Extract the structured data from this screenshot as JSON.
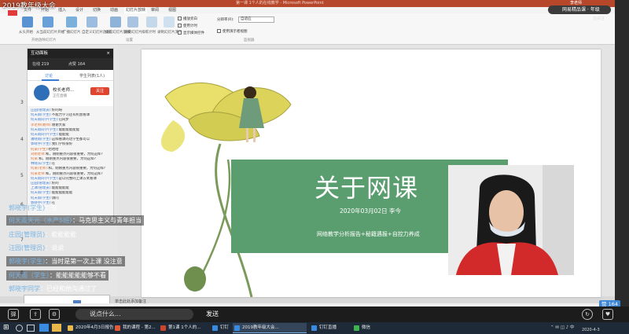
{
  "live": {
    "title": "2019教年级大会",
    "top_right_badge": "网易精品课 · 年级",
    "top_right_sub": "加关注"
  },
  "ppt": {
    "window_title": "第一课 1个人的在线教学 - Microsoft PowerPoint",
    "user": "李老师",
    "tabs": [
      "文件",
      "开始",
      "插入",
      "设计",
      "切换",
      "动画",
      "幻灯片放映",
      "审阅",
      "视图"
    ],
    "ribbon": {
      "buttons": [
        "从头开始",
        "从当前幻灯片开始",
        "广播幻灯片",
        "自定义幻灯片放映",
        "设置幻灯片放映",
        "隐藏幻灯片",
        "排练计时",
        "录制幻灯片演示"
      ],
      "groups": [
        "开始放映幻灯片",
        "设置",
        "监视器"
      ],
      "checks": [
        "播放旁白",
        "使用计时",
        "显示媒体控件"
      ],
      "resolution_label": "分辨率(R):",
      "resolution_value": "自适应",
      "presenter_view": "使用演示者视图"
    },
    "thumb_numbers": [
      "3",
      "4",
      "5",
      "6",
      "7",
      "8"
    ],
    "notes": "单击此处添加备注"
  },
  "slide": {
    "title": "关于网课",
    "date_line": "2020年03月02日 李今",
    "subtitle": "网络教学分析报告+秘籍遇报+自控力养成"
  },
  "panel": {
    "header": "互动面板",
    "close": "×",
    "online": "在线 219",
    "likes": "点赞 164",
    "tab_chat": "讨论",
    "tab_members": "学生列表(1人)",
    "teacher_name": "校长老师...",
    "teacher_role": "正在直播",
    "teacher_btn": "关注",
    "lines": [
      {
        "who": "庄园(管理员):",
        "msg": "好的呀",
        "color": "#3a7bd5"
      },
      {
        "who": "何天雨(学生):",
        "msg": "不能力学习还有机会看课",
        "color": "#3a7bd5"
      },
      {
        "who": "何天雨同学(学生):",
        "msg": "已同步",
        "color": "#3a7bd5"
      },
      {
        "who": "李老师(教师):",
        "msg": "谢谢大家",
        "color": "#e26b2a"
      },
      {
        "who": "何天雨同学(学生):",
        "msg": "能能能能能能",
        "color": "#3a7bd5"
      },
      {
        "who": "何天雨同学(学生):",
        "msg": "能能能",
        "color": "#3a7bd5"
      },
      {
        "who": "潘晓雨(学生):",
        "msg": "这样看课的话学生都可以",
        "color": "#3a7bd5"
      },
      {
        "who": "郭晓宇(学生):",
        "msg": "我们学校很好",
        "color": "#3a7bd5"
      },
      {
        "who": "何某(学生):",
        "msg": "哈哈哈",
        "color": "#e26b2a"
      },
      {
        "who": "刘刚老师:",
        "msg": "和，刚刚重点内容很重要，为何这样?",
        "color": "#e26b2a"
      },
      {
        "who": "何某:",
        "msg": "和，刚刚重点内容很重要，为何这样?",
        "color": "#e26b2a"
      },
      {
        "who": "林晓东(学生):",
        "msg": "在",
        "color": "#3a7bd5"
      },
      {
        "who": "何某(老师):",
        "msg": "和，刚刚重点内容很重要，为何这样?",
        "color": "#e26b2a"
      },
      {
        "who": "何某老师:",
        "msg": "和，刚刚重点内容很重要，为何这样?",
        "color": "#e26b2a"
      },
      {
        "who": "何天雨同学(学生):",
        "msg": "是以完整的上课方式看课",
        "color": "#3a7bd5"
      },
      {
        "who": "庄园(管理员):",
        "msg": "好的",
        "color": "#3a7bd5"
      },
      {
        "who": "上课(管理员):",
        "msg": "能能能能能",
        "color": "#3a7bd5"
      },
      {
        "who": "何天雨(学生):",
        "msg": "能能能能能能",
        "color": "#3a7bd5"
      },
      {
        "who": "何天雨(学生):",
        "msg": "请问",
        "color": "#3a7bd5"
      },
      {
        "who": "郭晓宇(学生):",
        "msg": "在",
        "color": "#3a7bd5"
      }
    ]
  },
  "danmaku": [
    {
      "name": "郭晓宇(学生)",
      "msg": "：在"
    },
    {
      "name": "何天雨天元（水产5班）",
      "msg": "：马克思主义与青年担当"
    },
    {
      "name": "庄园(管理员)",
      "msg": "：能能能能"
    },
    {
      "name": "汪园(管理员)",
      "msg": "：说说"
    },
    {
      "name": "郭晓宇(学生)",
      "msg": "：当时是第一次上课 没注意"
    },
    {
      "name": "何天雨（学生）",
      "msg": "：能能能能能够不看"
    },
    {
      "name": "郭晓宇同学",
      "msg": "：已经和他沟通过了"
    }
  ],
  "input": {
    "placeholder": "说点什么...",
    "send": "发送",
    "count": "赞 164"
  },
  "taskbar": {
    "items": [
      {
        "label": "2020年4月3日报告",
        "color": "#e8b84a"
      },
      {
        "label": "我的课程 - 第2...",
        "color": "#e05a3a"
      },
      {
        "label": "第1课 1个人的...",
        "color": "#c9452b"
      },
      {
        "label": "钉钉",
        "color": "#3a8be0"
      },
      {
        "label": "2019教年级大会...",
        "color": "#3a8be0"
      },
      {
        "label": "钉钉直播",
        "color": "#3a8be0"
      },
      {
        "label": "微信",
        "color": "#3fb34f"
      }
    ],
    "date": "2020-4-3"
  }
}
